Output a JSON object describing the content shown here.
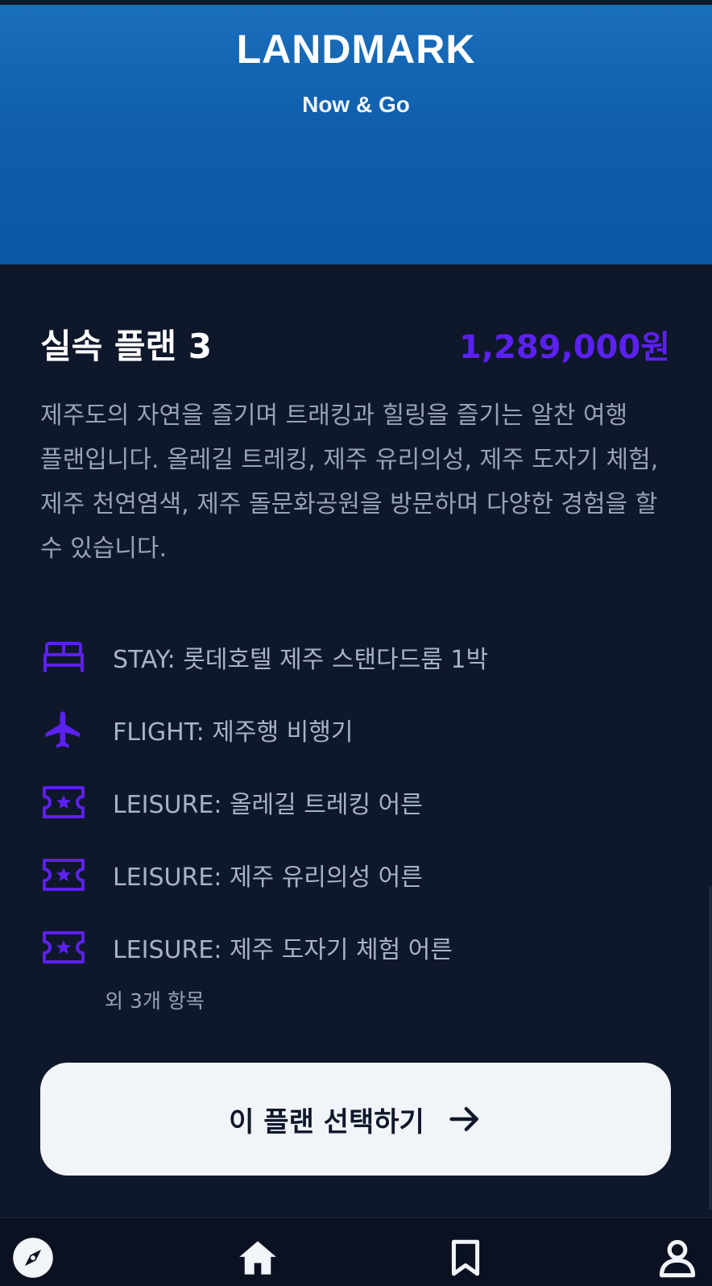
{
  "hero": {
    "title": "LANDMARK",
    "subtitle": "Now & Go"
  },
  "plan": {
    "title": "실속 플랜 3",
    "price": "1,289,000원",
    "description": "제주도의 자연을 즐기며 트래킹과 힐링을 즐기는 알찬 여행 플랜입니다. 올레길 트레킹, 제주 유리의성, 제주 도자기 체험, 제주 천연염색, 제주 돌문화공원을 방문하며 다양한 경험을 할 수 있습니다."
  },
  "items": [
    {
      "icon": "bed-icon",
      "text": "STAY: 롯데호텔 제주 스탠다드룸 1박"
    },
    {
      "icon": "airplane-icon",
      "text": "FLIGHT: 제주행 비행기"
    },
    {
      "icon": "ticket-icon",
      "text": "LEISURE: 올레길 트레킹 어른"
    },
    {
      "icon": "ticket-icon",
      "text": "LEISURE: 제주 유리의성 어른"
    },
    {
      "icon": "ticket-icon",
      "text": "LEISURE: 제주 도자기 체험 어른"
    }
  ],
  "more_items": "외 3개 항목",
  "cta": {
    "label": "이 플랜 선택하기"
  },
  "nav": [
    {
      "icon": "compass-icon"
    },
    {
      "icon": "home-icon"
    },
    {
      "icon": "bookmark-icon"
    },
    {
      "icon": "user-icon"
    }
  ],
  "colors": {
    "accent": "#5b21f0",
    "background": "#0f172a",
    "hero": "#0f5fae"
  }
}
